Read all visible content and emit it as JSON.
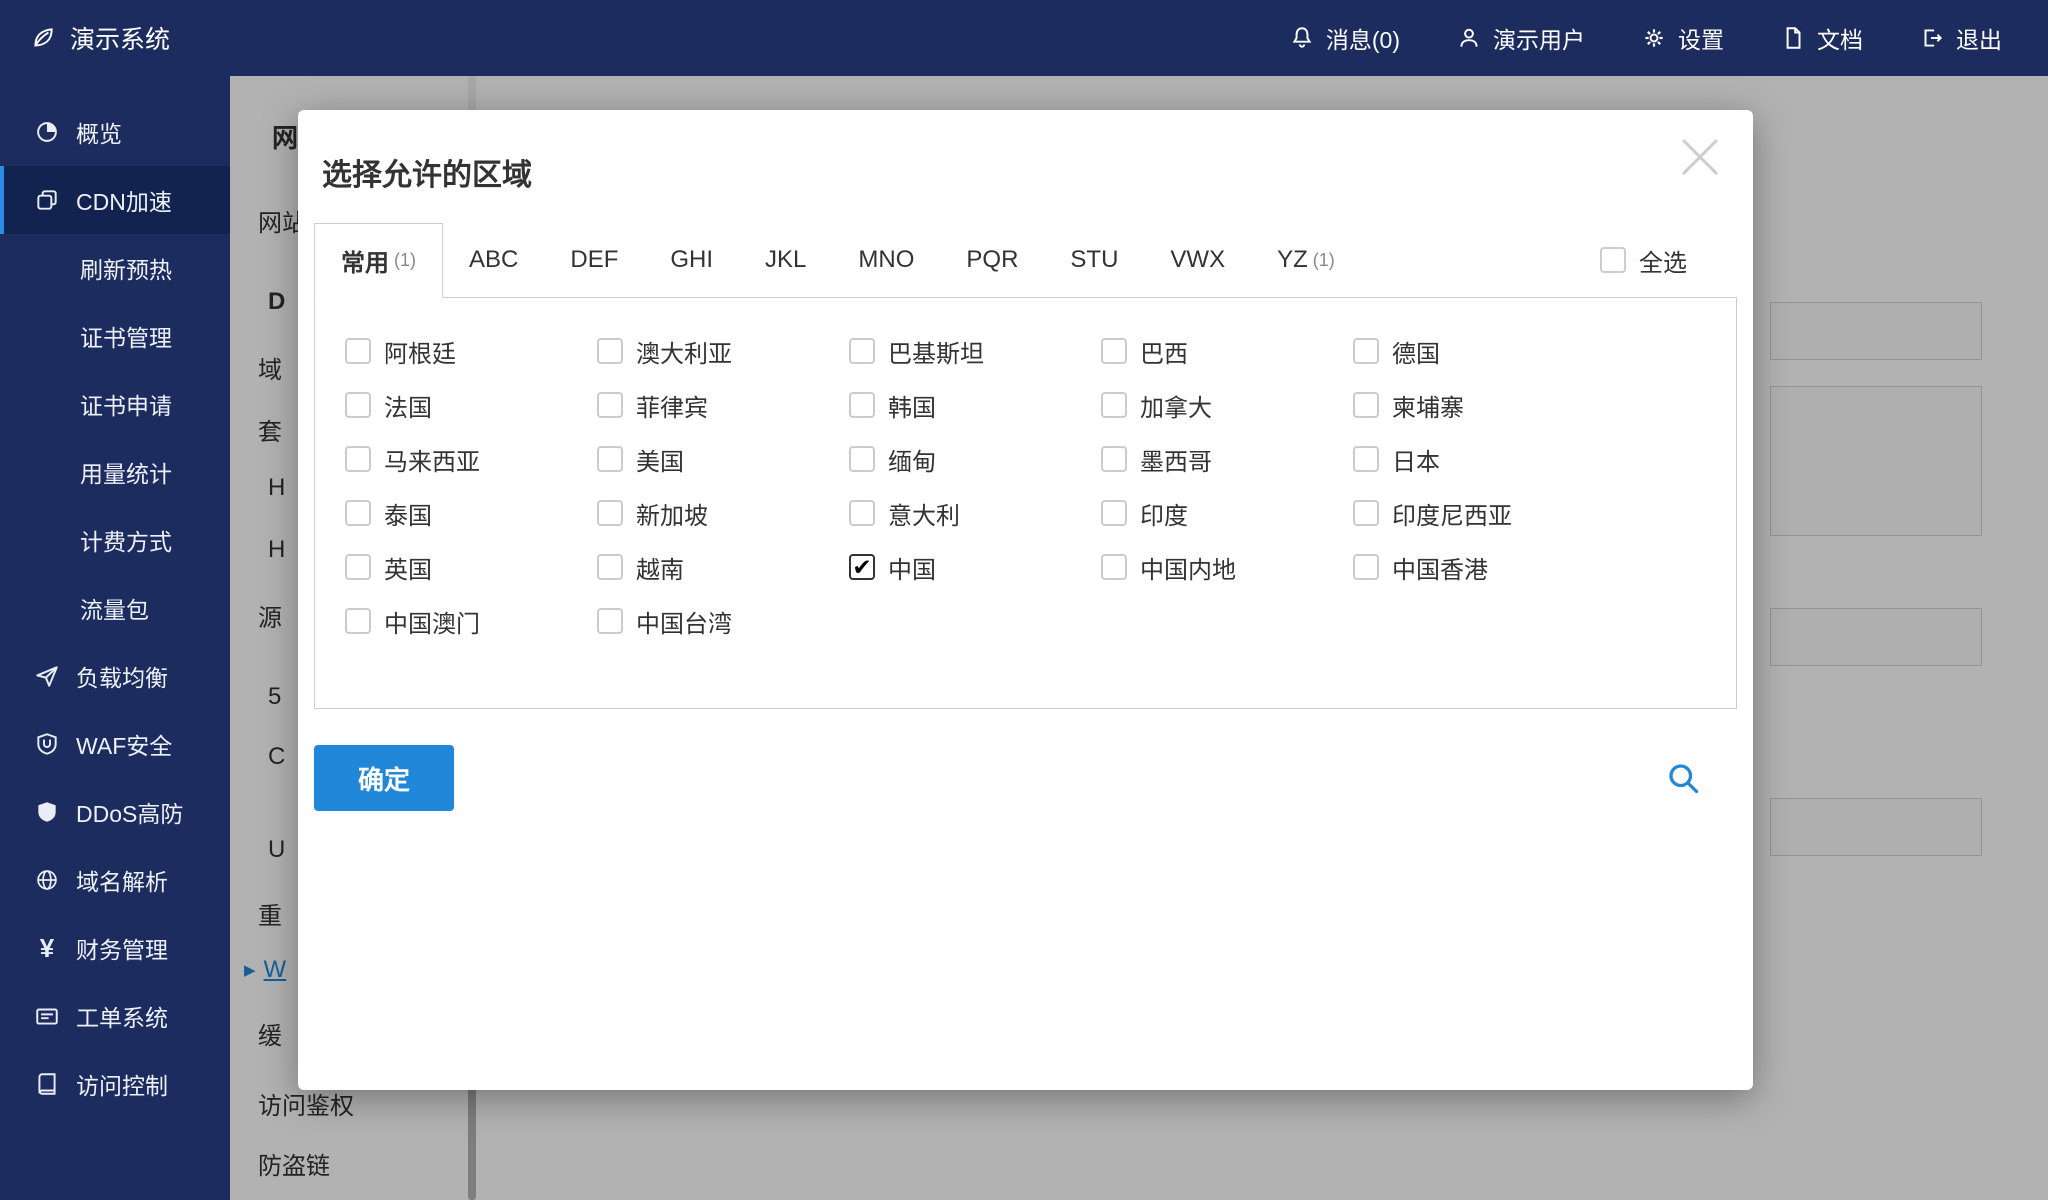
{
  "topbar": {
    "brand": "演示系统",
    "items": [
      {
        "icon": "bell-icon",
        "label": "消息(0)"
      },
      {
        "icon": "user-icon",
        "label": "演示用户"
      },
      {
        "icon": "gear-icon",
        "label": "设置"
      },
      {
        "icon": "document-icon",
        "label": "文档"
      },
      {
        "icon": "logout-icon",
        "label": "退出"
      }
    ]
  },
  "sidebar": {
    "items": [
      {
        "label": "概览",
        "icon": "overview-icon",
        "active": false,
        "sub": false
      },
      {
        "label": "CDN加速",
        "icon": "cdn-icon",
        "active": true,
        "sub": false
      },
      {
        "label": "刷新预热",
        "icon": "",
        "active": false,
        "sub": true
      },
      {
        "label": "证书管理",
        "icon": "",
        "active": false,
        "sub": true
      },
      {
        "label": "证书申请",
        "icon": "",
        "active": false,
        "sub": true
      },
      {
        "label": "用量统计",
        "icon": "",
        "active": false,
        "sub": true
      },
      {
        "label": "计费方式",
        "icon": "",
        "active": false,
        "sub": true
      },
      {
        "label": "流量包",
        "icon": "",
        "active": false,
        "sub": true
      },
      {
        "label": "负载均衡",
        "icon": "loadbalance-icon",
        "active": false,
        "sub": false
      },
      {
        "label": "WAF安全",
        "icon": "waf-shield-icon",
        "active": false,
        "sub": false
      },
      {
        "label": "DDoS高防",
        "icon": "ddos-shield-icon",
        "active": false,
        "sub": false
      },
      {
        "label": "域名解析",
        "icon": "globe-icon",
        "active": false,
        "sub": false
      },
      {
        "label": "财务管理",
        "icon": "yen-icon",
        "active": false,
        "sub": false
      },
      {
        "label": "工单系统",
        "icon": "ticket-icon",
        "active": false,
        "sub": false
      },
      {
        "label": "访问控制",
        "icon": "access-book-icon",
        "active": false,
        "sub": false
      }
    ]
  },
  "background": {
    "fragments": [
      "网",
      "网站",
      "D",
      "域",
      "套",
      "H",
      "H",
      "源",
      "5",
      "C",
      "U",
      "重",
      "缓",
      "访问鉴权",
      "防盗链"
    ],
    "link_fragment": {
      "arrow": "▶",
      "text": "W"
    }
  },
  "modal": {
    "title": "选择允许的区域",
    "tabs": [
      {
        "label": "常用",
        "count": "(1)",
        "active": true
      },
      {
        "label": "ABC",
        "count": "",
        "active": false
      },
      {
        "label": "DEF",
        "count": "",
        "active": false
      },
      {
        "label": "GHI",
        "count": "",
        "active": false
      },
      {
        "label": "JKL",
        "count": "",
        "active": false
      },
      {
        "label": "MNO",
        "count": "",
        "active": false
      },
      {
        "label": "PQR",
        "count": "",
        "active": false
      },
      {
        "label": "STU",
        "count": "",
        "active": false
      },
      {
        "label": "VWX",
        "count": "",
        "active": false
      },
      {
        "label": "YZ",
        "count": "(1)",
        "active": false
      }
    ],
    "select_all_label": "全选",
    "regions": [
      {
        "label": "阿根廷",
        "checked": false
      },
      {
        "label": "澳大利亚",
        "checked": false
      },
      {
        "label": "巴基斯坦",
        "checked": false
      },
      {
        "label": "巴西",
        "checked": false
      },
      {
        "label": "德国",
        "checked": false
      },
      {
        "label": "法国",
        "checked": false
      },
      {
        "label": "菲律宾",
        "checked": false
      },
      {
        "label": "韩国",
        "checked": false
      },
      {
        "label": "加拿大",
        "checked": false
      },
      {
        "label": "柬埔寨",
        "checked": false
      },
      {
        "label": "马来西亚",
        "checked": false
      },
      {
        "label": "美国",
        "checked": false
      },
      {
        "label": "缅甸",
        "checked": false
      },
      {
        "label": "墨西哥",
        "checked": false
      },
      {
        "label": "日本",
        "checked": false
      },
      {
        "label": "泰国",
        "checked": false
      },
      {
        "label": "新加坡",
        "checked": false
      },
      {
        "label": "意大利",
        "checked": false
      },
      {
        "label": "印度",
        "checked": false
      },
      {
        "label": "印度尼西亚",
        "checked": false
      },
      {
        "label": "英国",
        "checked": false
      },
      {
        "label": "越南",
        "checked": false
      },
      {
        "label": "中国",
        "checked": true
      },
      {
        "label": "中国内地",
        "checked": false
      },
      {
        "label": "中国香港",
        "checked": false
      },
      {
        "label": "中国澳门",
        "checked": false
      },
      {
        "label": "中国台湾",
        "checked": false
      }
    ],
    "check_glyph": "✔",
    "confirm_label": "确定"
  },
  "colors": {
    "navy": "#1c2c5e",
    "accent_blue": "#2187d8",
    "active_item": "#132350"
  }
}
